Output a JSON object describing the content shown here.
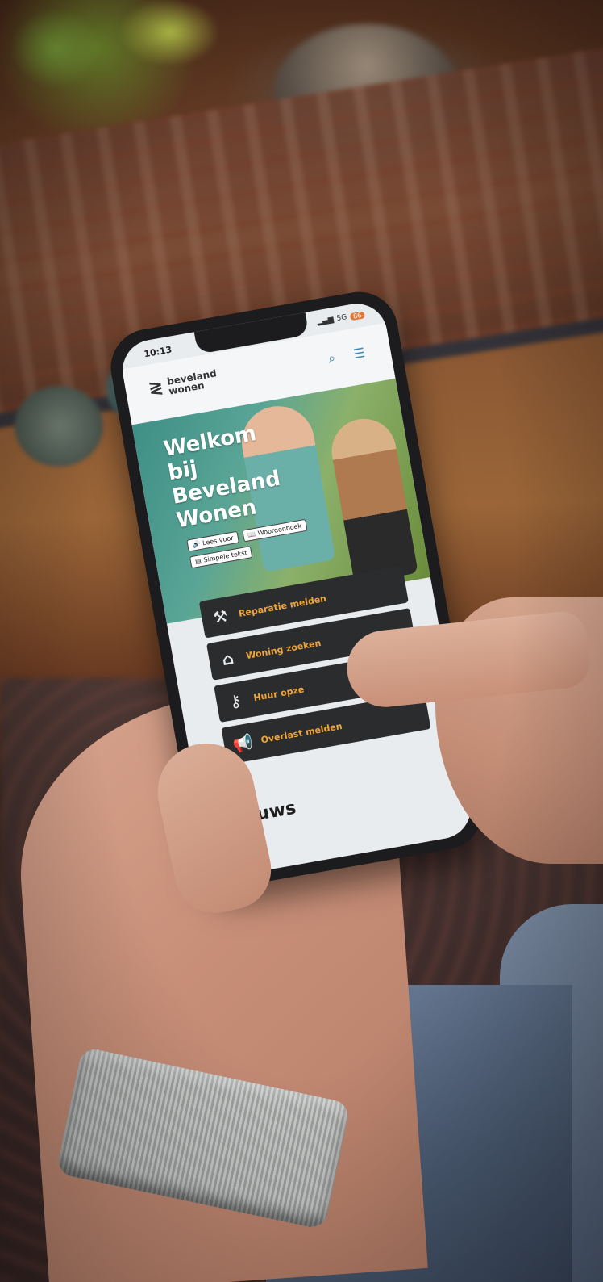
{
  "status": {
    "time": "10:13",
    "network": "5G",
    "battery": "86"
  },
  "brand": {
    "line1": "beveland",
    "line2": "wonen"
  },
  "header": {
    "search_icon": "search-icon",
    "menu_icon": "menu-icon"
  },
  "hero": {
    "title_line1": "Welkom",
    "title_line2": "bij",
    "title_line3": "Beveland",
    "title_line4": "Wonen"
  },
  "accessibility": {
    "read_aloud": "Lees voor",
    "dictionary": "Woordenboek",
    "simple_text": "Simpele tekst"
  },
  "actions": [
    {
      "label": "Reparatie melden",
      "icon": "tools-icon"
    },
    {
      "label": "Woning zoeken",
      "icon": "house-search-icon"
    },
    {
      "label": "Huur opze",
      "icon": "keys-icon"
    },
    {
      "label": "Overlast melden",
      "icon": "megaphone-icon"
    }
  ],
  "news": {
    "title": "Nieuws"
  },
  "colors": {
    "accent": "#f0a43a",
    "button_bg": "#2a2c2e",
    "link": "#3a8abf"
  }
}
